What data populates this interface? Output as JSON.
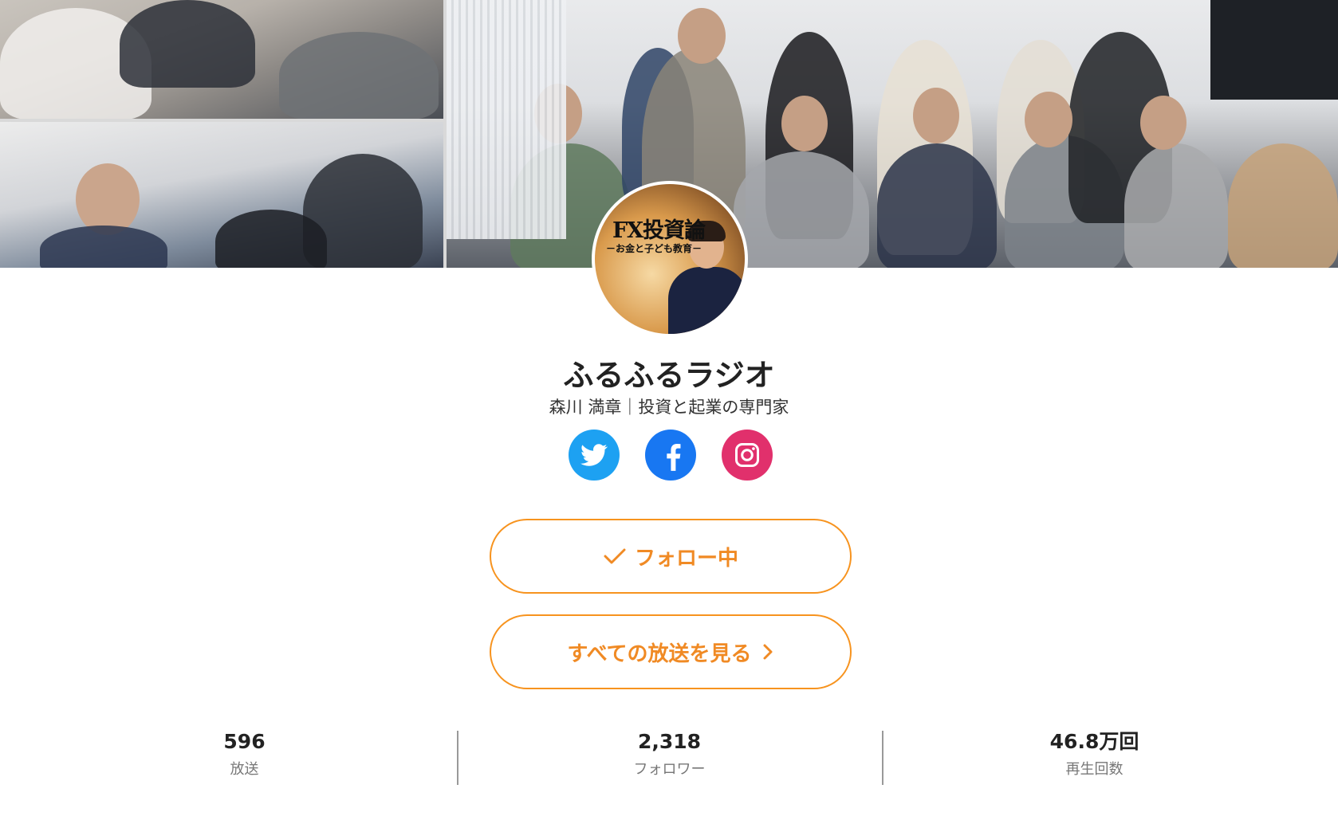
{
  "profile": {
    "name": "ふるふるラジオ",
    "subtitle": "森川 満章｜投資と起業の専門家",
    "avatar_title": "FX投資論",
    "avatar_subtitle": "－お金と子ども教育－"
  },
  "social": [
    {
      "name": "twitter",
      "icon": "twitter-icon",
      "color": "#1da1f2"
    },
    {
      "name": "facebook",
      "icon": "facebook-icon",
      "color": "#1877f2"
    },
    {
      "name": "instagram",
      "icon": "instagram-icon",
      "color": "#e1306c"
    }
  ],
  "buttons": {
    "follow_label": "フォロー中",
    "all_broadcasts_label": "すべての放送を見る",
    "accent_color": "#f7931e"
  },
  "stats": [
    {
      "value": "596",
      "label": "放送"
    },
    {
      "value": "2,318",
      "label": "フォロワー"
    },
    {
      "value": "46.8万回",
      "label": "再生回数"
    }
  ]
}
